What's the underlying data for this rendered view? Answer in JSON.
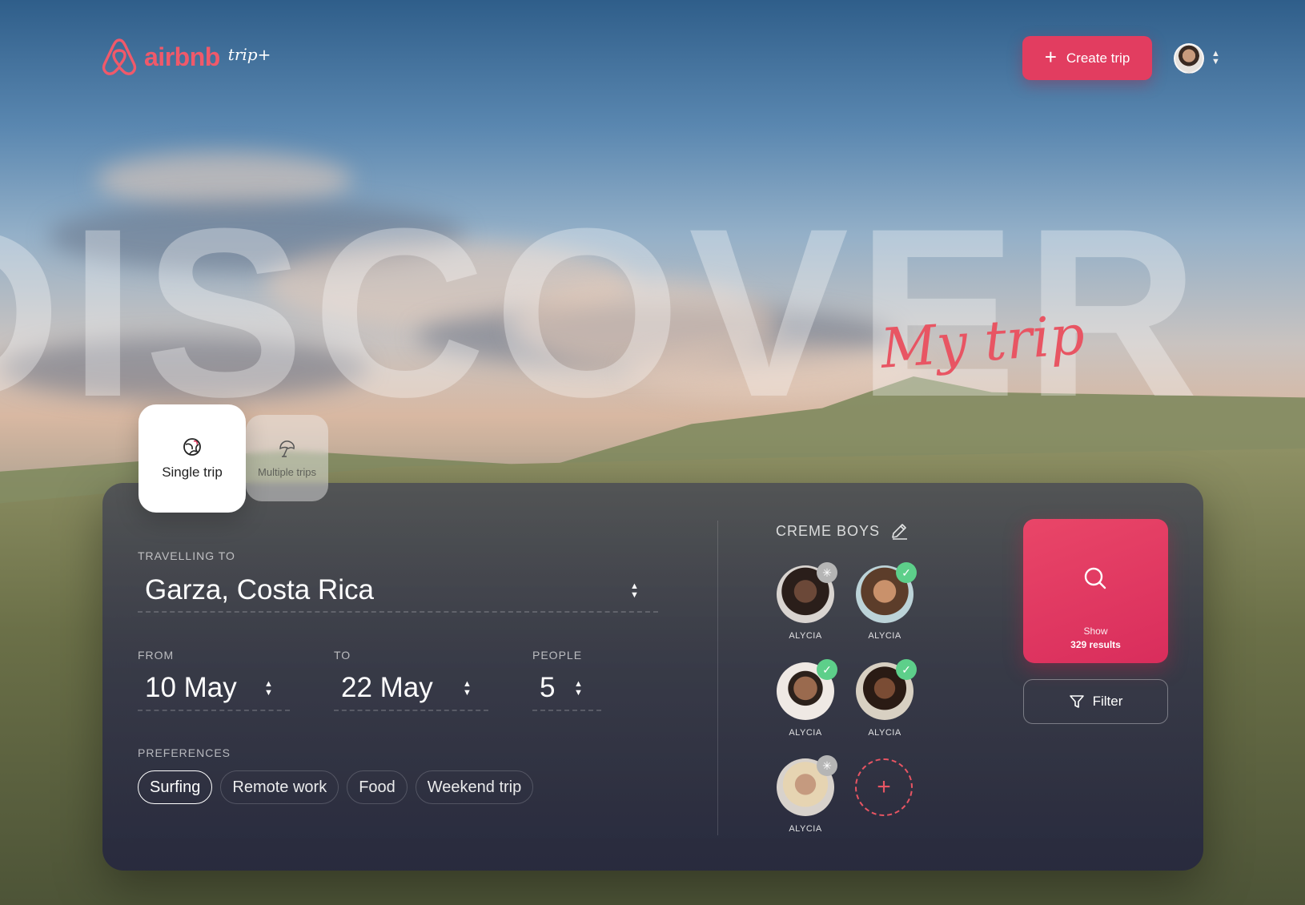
{
  "header": {
    "brand": "airbnb",
    "brand_sub": "trip+",
    "create_label": "Create trip",
    "user_menu_toggle": "⬍"
  },
  "hero": {
    "background_word": "DISCOVER",
    "script_title": "My trip"
  },
  "trip_types": [
    {
      "label": "Single trip",
      "icon": "beach-ball-icon",
      "selected": true
    },
    {
      "label": "Multiple trips",
      "icon": "umbrella-icon",
      "selected": false
    }
  ],
  "search": {
    "destination": {
      "label": "TRAVELLING TO",
      "value": "Garza, Costa Rica"
    },
    "from": {
      "label": "FROM",
      "value": "10 May"
    },
    "to": {
      "label": "TO",
      "value": "22 May"
    },
    "people": {
      "label": "PEOPLE",
      "value": "5"
    },
    "preferences": {
      "label": "PREFERENCES",
      "chips": [
        {
          "label": "Surfing",
          "active": true
        },
        {
          "label": "Remote work",
          "active": false
        },
        {
          "label": "Food",
          "active": false
        },
        {
          "label": "Weekend trip",
          "active": false
        }
      ]
    }
  },
  "group": {
    "name": "CREME BOYS",
    "members": [
      {
        "name": "ALYCIA",
        "status": "pending"
      },
      {
        "name": "ALYCIA",
        "status": "confirmed"
      },
      {
        "name": "ALYCIA",
        "status": "confirmed"
      },
      {
        "name": "ALYCIA",
        "status": "confirmed"
      },
      {
        "name": "ALYCIA",
        "status": "pending"
      }
    ]
  },
  "actions": {
    "show_label": "Show",
    "results_label": "329 results",
    "filter_label": "Filter"
  },
  "colors": {
    "accent": "#e23d60",
    "script": "#e85563",
    "confirmed": "#5dcf8a",
    "pending": "#b5b5b5"
  }
}
